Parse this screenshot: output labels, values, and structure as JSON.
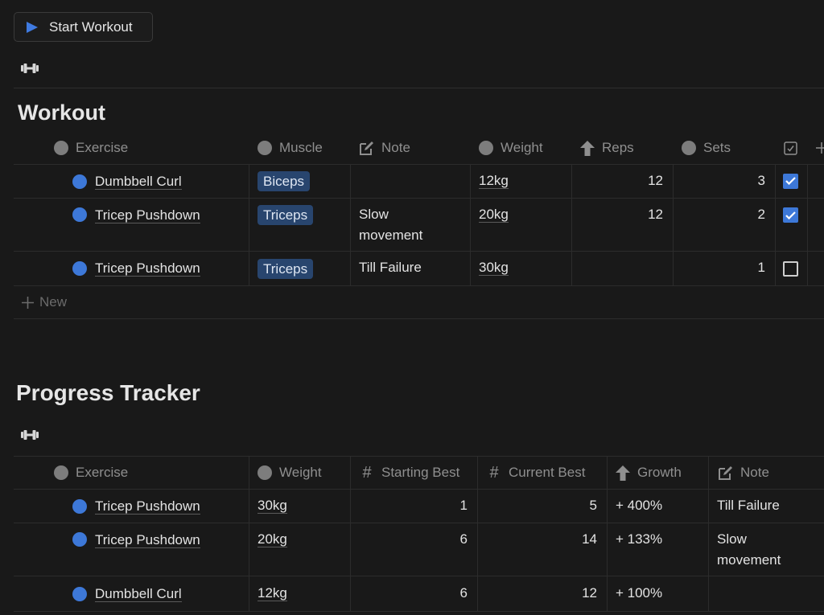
{
  "toolbar": {
    "start_button_label": "Start Workout"
  },
  "workout": {
    "title": "Workout",
    "columns": [
      {
        "label": "Exercise",
        "icon": "circle-icon"
      },
      {
        "label": "Muscle",
        "icon": "circle-icon"
      },
      {
        "label": "Note",
        "icon": "edit-icon"
      },
      {
        "label": "Weight",
        "icon": "circle-icon"
      },
      {
        "label": "Reps",
        "icon": "arrow-up-icon"
      },
      {
        "label": "Sets",
        "icon": "circle-icon"
      },
      {
        "label": "",
        "icon": "checkbox-icon"
      },
      {
        "label": "",
        "icon": "plus-icon"
      }
    ],
    "rows": [
      {
        "exercise": "Dumbbell Curl",
        "muscle": "Biceps",
        "note": "",
        "weight": "12kg",
        "reps": "12",
        "sets": "3",
        "done": true
      },
      {
        "exercise": "Tricep Pushdown",
        "muscle": "Triceps",
        "note": "Slow movement",
        "weight": "20kg",
        "reps": "12",
        "sets": "2",
        "done": true
      },
      {
        "exercise": "Tricep Pushdown",
        "muscle": "Triceps",
        "note": "Till Failure",
        "weight": "30kg",
        "reps": "",
        "sets": "1",
        "done": false
      }
    ],
    "new_label": "New"
  },
  "progress": {
    "title": "Progress Tracker",
    "columns": [
      {
        "label": "Exercise",
        "icon": "circle-icon"
      },
      {
        "label": "Weight",
        "icon": "circle-icon"
      },
      {
        "label": "Starting Best",
        "icon": "hash-icon"
      },
      {
        "label": "Current Best",
        "icon": "hash-icon"
      },
      {
        "label": "Growth",
        "icon": "arrow-up-icon"
      },
      {
        "label": "Note",
        "icon": "edit-icon"
      }
    ],
    "rows": [
      {
        "exercise": "Tricep Pushdown",
        "weight": "30kg",
        "starting_best": "1",
        "current_best": "5",
        "growth": "+ 400%",
        "note": "Till Failure"
      },
      {
        "exercise": "Tricep Pushdown",
        "weight": "20kg",
        "starting_best": "6",
        "current_best": "14",
        "growth": "+ 133%",
        "note": "Slow movement"
      },
      {
        "exercise": "Dumbbell Curl",
        "weight": "12kg",
        "starting_best": "6",
        "current_best": "12",
        "growth": "+ 100%",
        "note": ""
      }
    ]
  },
  "colors": {
    "accent": "#3d78d8",
    "tag_bg": "#28456e",
    "background": "#191919"
  }
}
